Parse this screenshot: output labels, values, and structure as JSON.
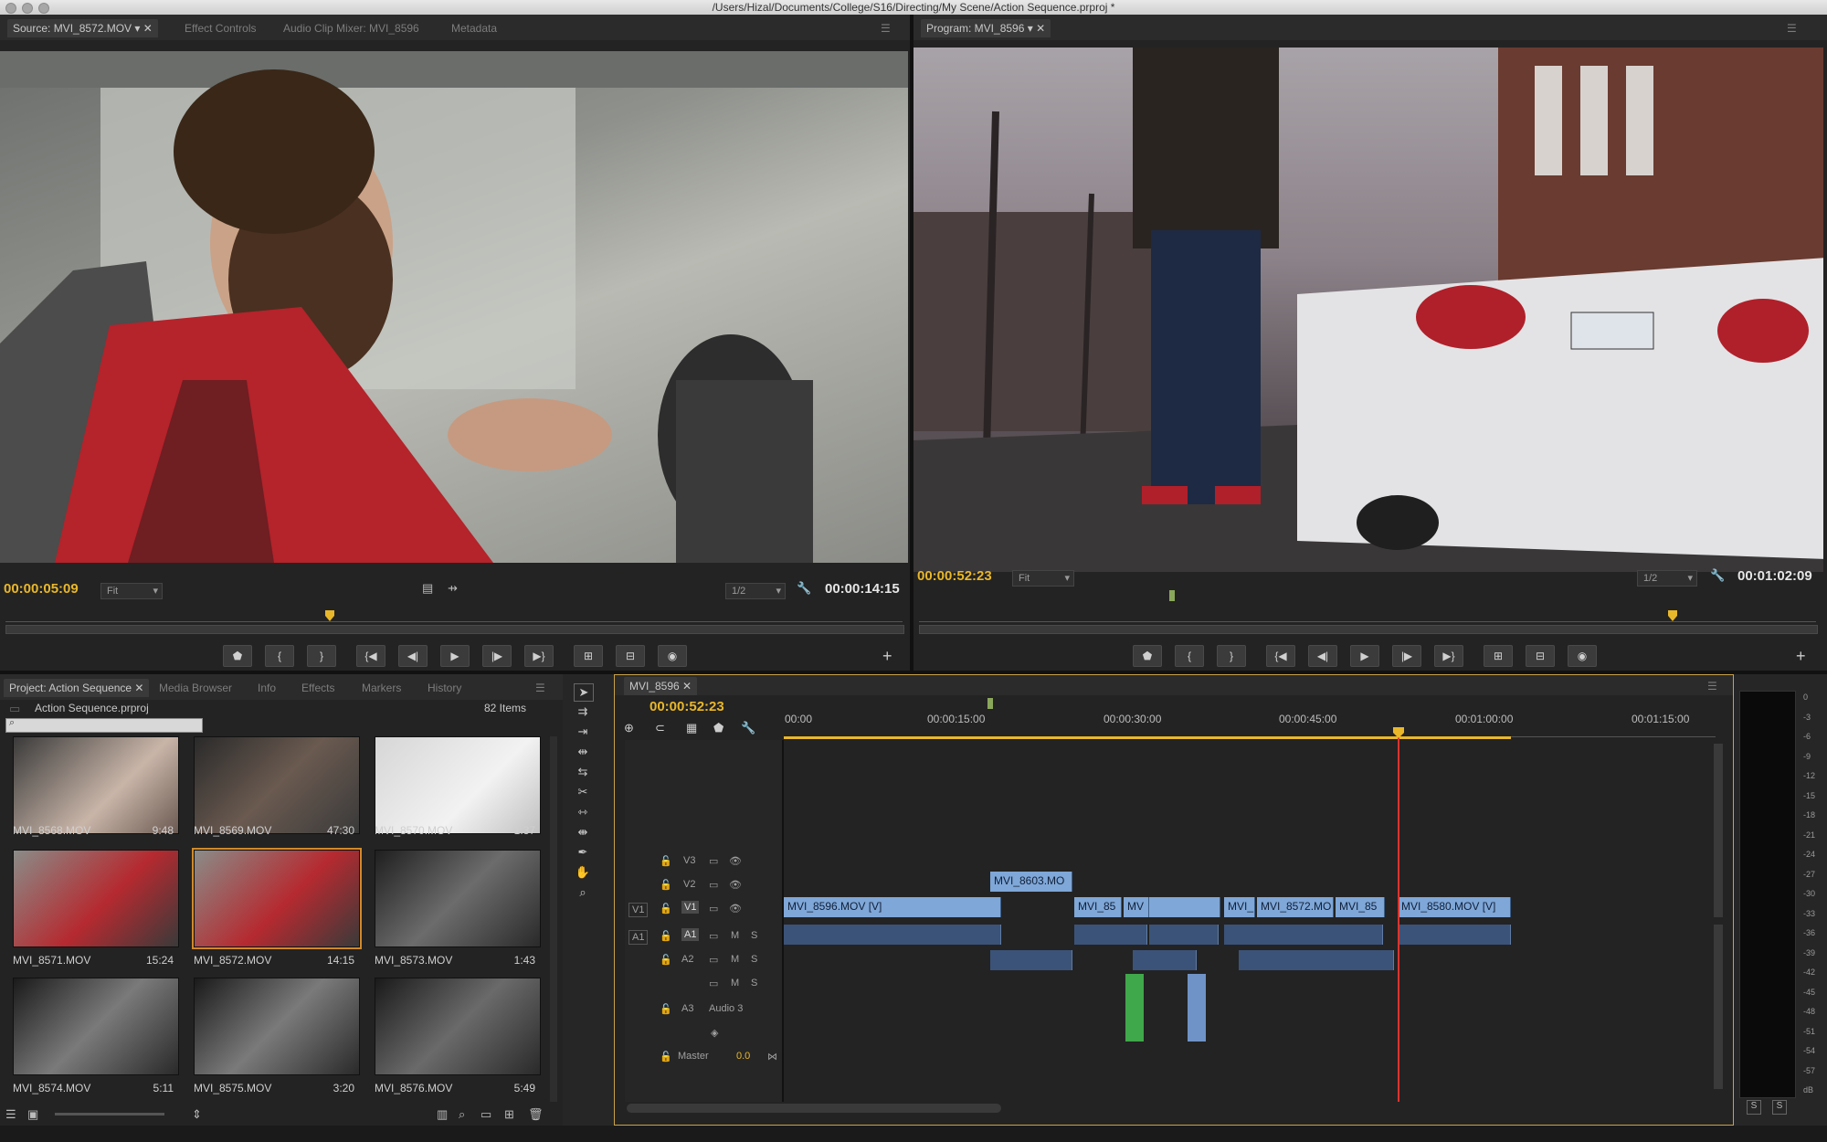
{
  "window": {
    "title": "/Users/Hizal/Documents/College/S16/Directing/My Scene/Action Sequence.prproj *"
  },
  "source_monitor": {
    "tabs": [
      "Source: MVI_8572.MOV",
      "Effect Controls",
      "Audio Clip Mixer: MVI_8596",
      "Metadata"
    ],
    "current_tc": "00:00:05:09",
    "duration_tc": "00:00:14:15",
    "zoom": "Fit",
    "resolution": "1/2"
  },
  "program_monitor": {
    "tab": "Program: MVI_8596",
    "current_tc": "00:00:52:23",
    "duration_tc": "00:01:02:09",
    "zoom": "Fit",
    "resolution": "1/2"
  },
  "project": {
    "tabs": [
      "Project: Action Sequence",
      "Media Browser",
      "Info",
      "Effects",
      "Markers",
      "History"
    ],
    "file": "Action Sequence.prproj",
    "items_count": "82 Items",
    "search_placeholder": "",
    "clips": [
      {
        "name": "MVI_8568.MOV",
        "dur": "9:48"
      },
      {
        "name": "MVI_8569.MOV",
        "dur": "47:30"
      },
      {
        "name": "MVI_8570.MOV",
        "dur": "1:37"
      },
      {
        "name": "MVI_8571.MOV",
        "dur": "15:24"
      },
      {
        "name": "MVI_8572.MOV",
        "dur": "14:15"
      },
      {
        "name": "MVI_8573.MOV",
        "dur": "1:43"
      },
      {
        "name": "MVI_8574.MOV",
        "dur": "5:11"
      },
      {
        "name": "MVI_8575.MOV",
        "dur": "3:20"
      },
      {
        "name": "MVI_8576.MOV",
        "dur": "5:49"
      }
    ]
  },
  "timeline": {
    "tab": "MVI_8596",
    "current_tc": "00:00:52:23",
    "ruler": [
      "00:00",
      "00:00:15:00",
      "00:00:30:00",
      "00:00:45:00",
      "00:01:00:00",
      "00:01:15:00"
    ],
    "tracks": {
      "v3": "V3",
      "v2": "V2",
      "v1": "V1",
      "v1src": "V1",
      "a1": "A1",
      "a1src": "A1",
      "a2": "A2",
      "a3": "A3",
      "a3name": "Audio 3",
      "master": "Master",
      "master_val": "0.0",
      "m": "M",
      "s": "S"
    },
    "clips": {
      "c1": "MVI_8596.MOV [V]",
      "c2": "MVI_8603.MO",
      "c3": "MVI_85",
      "c4": "MV",
      "c5": "MVI_",
      "c6": "MVI_8572.MO",
      "c7": "MVI_85",
      "c8": "MVI_8580.MOV [V]"
    }
  },
  "audio_meter": {
    "scale": [
      "0",
      "-3",
      "-6",
      "-9",
      "-12",
      "-15",
      "-18",
      "-21",
      "-24",
      "-27",
      "-30",
      "-33",
      "-36",
      "-39",
      "-42",
      "-45",
      "-48",
      "-51",
      "-54",
      "-57",
      "dB"
    ],
    "solo_labels": [
      "S",
      "S"
    ]
  },
  "colors": {
    "accent": "#e9b72a",
    "playhead": "#d9352e",
    "clip_video": "#7fa7d7",
    "clip_audio": "#3b5378",
    "audio_green": "#3fa84a"
  }
}
